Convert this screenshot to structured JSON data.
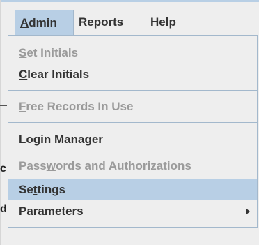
{
  "background": {
    "mark_1": "c",
    "mark_2": "d"
  },
  "menubar": {
    "admin": {
      "mnemonic": "A",
      "rest": "dmin"
    },
    "reports": {
      "pre": "Re",
      "mnemonic": "p",
      "rest": "orts"
    },
    "help": {
      "mnemonic": "H",
      "rest": "elp"
    }
  },
  "admin_menu": {
    "set_initials": {
      "mnemonic": "S",
      "rest": "et Initials",
      "enabled": false
    },
    "clear_initials": {
      "mnemonic": "C",
      "rest": "lear Initials",
      "enabled": true
    },
    "free_records": {
      "mnemonic": "F",
      "rest": "ree Records In Use",
      "enabled": false
    },
    "login_manager": {
      "mnemonic": "L",
      "rest": "ogin Manager",
      "enabled": true
    },
    "passwords": {
      "pre": "Pass",
      "mnemonic": "w",
      "rest": "ords and Authorizations",
      "enabled": false
    },
    "settings": {
      "pre": "Se",
      "mnemonic": "t",
      "rest": "tings",
      "enabled": true,
      "highlighted": true
    },
    "parameters": {
      "mnemonic": "P",
      "rest": "arameters",
      "enabled": true,
      "has_submenu": true
    }
  },
  "colors": {
    "highlight": "#b8cfe5",
    "border": "#a3b8cc",
    "text": "#333333",
    "disabled_text": "#9a9a9a",
    "background": "#eeeeee"
  },
  "icons": {
    "submenu_arrow": "chevron-right-icon"
  }
}
